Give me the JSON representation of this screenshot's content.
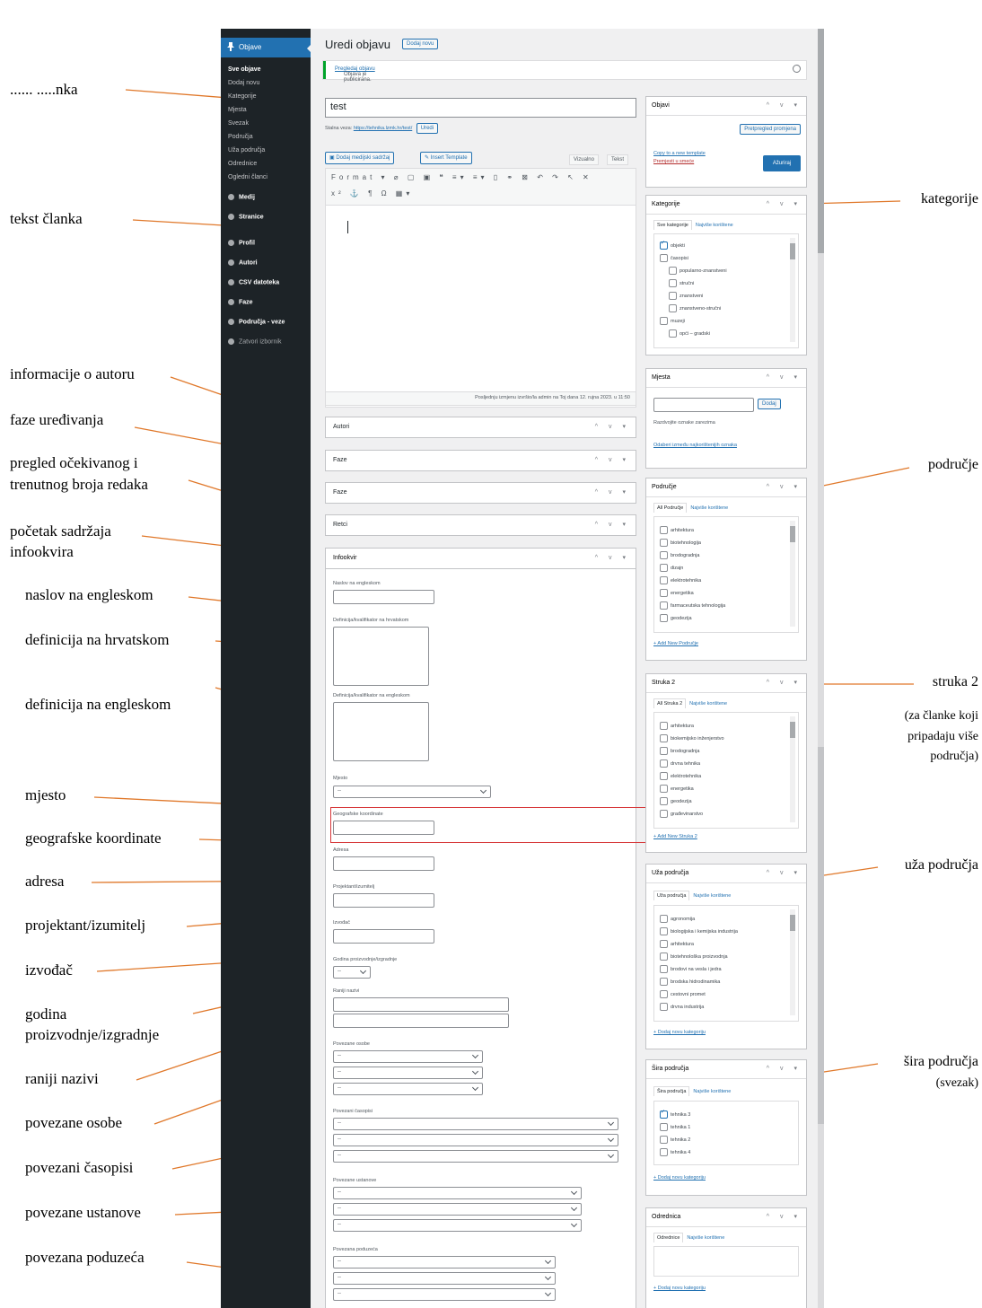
{
  "sidebar": {
    "current": "Objave",
    "submenu": [
      "Sve objave",
      "Dodaj novu",
      "Kategorije",
      "Mjesta",
      "Svezak",
      "Područja",
      "Uža područja",
      "Odrednice",
      "Ogledni članci"
    ],
    "menu": [
      "Medij",
      "Stranice",
      "Profil",
      "Autori",
      "CSV datoteka",
      "Faze",
      "Područja - veze",
      "Zatvori izbornik"
    ]
  },
  "header": {
    "title": "Uredi objavu",
    "add_new": "Dodaj novu"
  },
  "notice": {
    "text": "Objava je publicirana.",
    "link": "Pregledaj objavu"
  },
  "post": {
    "title": "test",
    "permalink_label": "Stalna veza:",
    "permalink_url": "https://tehnika.lzmk.hr/test/",
    "permalink_edit": "Uredi"
  },
  "editor": {
    "add_media": "Dodaj medijski sadržaj",
    "insert_template": "Insert Template",
    "tab_visual": "Vizualno",
    "tab_text": "Tekst",
    "toolbar_row1": "Format ▾ ⌀ ▢ ▣ ❝ ≡▾ ≡▾ ▯ ⚭ ⊠ ↶ ↷ ↖ ✕",
    "toolbar_row2": "x² ⚓ ¶ Ω ▦▾",
    "word_count": "Posljednju izmjenu izvršio/la admin na Toj dana 12. rujna 2023. u 11:50"
  },
  "metaboxes": [
    "Autori",
    "Faze",
    "Faze",
    "Retci"
  ],
  "infobox": {
    "title": "Infookvir",
    "fields": {
      "naslov_en": "Naslov na engleskom",
      "def_hr": "Definicija/kvalifikator na hrvatskom",
      "def_en": "Definicija/kvalifikator na engleskom",
      "mjesto": "Mjesto",
      "koordinate": "Geografske koordinate",
      "adresa": "Adresa",
      "projektant": "Projektant/izumitelj",
      "izvodac": "Izvođač",
      "godina": "Godina proizvodnje/izgradnje",
      "raniji": "Raniji nazivi",
      "osobe": "Povezane osobe",
      "casopisi": "Povezani časopisi",
      "ustanove": "Povezane ustanove",
      "poduzeca": "Povezana poduzeća"
    },
    "select_placeholder": "--"
  },
  "publish": {
    "title": "Objavi",
    "preview_changes": "Pretpregled promjena",
    "copy_draft": "Copy to a new template",
    "move_trash": "Premjesti u smeće",
    "update": "Ažuriraj"
  },
  "categories": {
    "title": "Kategorije",
    "tab_all": "Sve kategorije",
    "tab_popular": "Najviše korištene",
    "items": [
      {
        "label": "objekti",
        "checked": true,
        "child": false
      },
      {
        "label": "časopisi",
        "checked": false,
        "child": false
      },
      {
        "label": "popularno-znanstveni",
        "checked": false,
        "child": true
      },
      {
        "label": "stručni",
        "checked": false,
        "child": true
      },
      {
        "label": "znanstveni",
        "checked": false,
        "child": true
      },
      {
        "label": "znanstveno-stručni",
        "checked": false,
        "child": true
      },
      {
        "label": "muzeji",
        "checked": false,
        "child": false
      },
      {
        "label": "opći – gradski",
        "checked": false,
        "child": true
      }
    ]
  },
  "mjesta": {
    "title": "Mjesta",
    "add": "Dodaj",
    "hint": "Razdvojite oznake zarezima",
    "choose": "Odaberi između najkorištenijih oznaka"
  },
  "podrucje": {
    "title": "Područje",
    "tab_all": "All Područje",
    "tab_popular": "Najviše korištene",
    "items": [
      "arhitektura",
      "biotehnologija",
      "brodogradnja",
      "dizajn",
      "elektrotehnika",
      "energetika",
      "farmaceutska tehnologija",
      "geodezija"
    ],
    "add_link": "+ Add New Područje"
  },
  "struka2": {
    "title": "Struka 2",
    "tab_all": "All Struka 2",
    "tab_popular": "Najviše korištene",
    "items": [
      "arhitektura",
      "biokemijsko inženjerstvo",
      "brodogradnja",
      "drvna tehnika",
      "elektrotehnika",
      "energetika",
      "geodezija",
      "građevinarstvo"
    ],
    "add_link": "+ Add New Struka 2"
  },
  "uza": {
    "title": "Uža područja",
    "tab_all": "Uža područja",
    "tab_popular": "Najviše korištene",
    "items": [
      "agronomija",
      "biologijska i kemijska industrija",
      "arhitektura",
      "biotehnološka proizvodnja",
      "brodovi na vesla i jedra",
      "brodska hidrodinamika",
      "cestovni promet",
      "drvna industrija"
    ],
    "add_link": "+ Dodaj novu kategoriju"
  },
  "sira": {
    "title": "Šira područja",
    "tab_all": "Šira područja",
    "tab_popular": "Najviše korištene",
    "items": [
      {
        "label": "tehnika 3",
        "checked": true
      },
      {
        "label": "tehnika 1",
        "checked": false
      },
      {
        "label": "tehnika 2",
        "checked": false
      },
      {
        "label": "tehnika 4",
        "checked": false
      }
    ],
    "add_link": "+ Dodaj novu kategoriju"
  },
  "odrednica": {
    "title": "Odrednica",
    "tab_all": "Odrednice",
    "tab_popular": "Najviše korištene",
    "add_link": "+ Dodaj novu kategoriju"
  },
  "annotations": {
    "naslov": "...... .....nka",
    "tekst": "tekst članka",
    "autor": "informacije o autoru",
    "faze": "faze uređivanja",
    "pregled1": "pregled očekivanog i",
    "pregled2": "trenutnog broja redaka",
    "pocetak1": "početak sadržaja",
    "pocetak2": "infookvira",
    "naslov_en": "naslov na engleskom",
    "def_hr": "definicija na hrvatskom",
    "def_en": "definicija na engleskom",
    "mjesto": "mjesto",
    "koord": "geografske koordinate",
    "adresa": "adresa",
    "projektant": "projektant/izumitelj",
    "izvodac": "izvođač",
    "godina1": "godina",
    "godina2": "proizvodnje/izgradnje",
    "raniji": "raniji nazivi",
    "osobe": "povezane osobe",
    "casopisi": "povezani časopisi",
    "ustanove": "povezane ustanove",
    "poduzeca": "povezana poduzeća",
    "kategorije": "kategorije",
    "podrucje": "područje",
    "struka": "struka 2",
    "struka_n1": "(za članke koji",
    "struka_n2": "pripadaju više",
    "struka_n3": "područja)",
    "uza": "uža područja",
    "sira1": "šira područja",
    "sira2": "(svezak)"
  },
  "colors": {
    "arrow": "#e0782a",
    "sidebar": "#1d2327",
    "accent": "#2271b1",
    "highlight": "#d63638"
  }
}
